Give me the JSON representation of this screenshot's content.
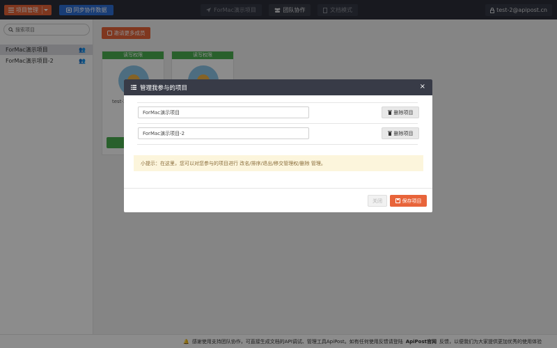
{
  "topbar": {
    "project_menu_label": "项目管理",
    "sync_label": "同步协作数据",
    "tabs": [
      {
        "label": "ForMac演示项目"
      },
      {
        "label": "团队协作"
      },
      {
        "label": "文档模式"
      }
    ],
    "user_email": "test-2@apipost.cn"
  },
  "sidebar": {
    "search_placeholder": "搜索项目",
    "items": [
      {
        "label": "ForMac演示项目"
      },
      {
        "label": "ForMac演示项目-2"
      }
    ]
  },
  "main": {
    "invite_label": "邀请更多成员",
    "cards": [
      {
        "permission": "读写权限",
        "name": "test-2"
      },
      {
        "permission": "读写权限"
      }
    ]
  },
  "modal": {
    "title": "管理我参与的项目",
    "close_symbol": "×",
    "projects": [
      {
        "name": "ForMac演示项目",
        "delete_label": "删除项目"
      },
      {
        "name": "ForMac演示项目-2",
        "delete_label": "删除项目"
      }
    ],
    "tip": "小提示：在这里，您可以对您参与的项目进行 改名/排序/退出/移交管理权/删除 管理。",
    "close_button": "关闭",
    "save_button": "保存项目"
  },
  "footer": {
    "text": "感谢使用支持团队协作，可直接生成文档的API调试、管理工具ApiPost。如有任何使用反馈请登陆",
    "link": "ApiPost官网",
    "tail": "反馈，以便我们为大家提供更加优秀的使用体验"
  },
  "colors": {
    "accent": "#e8643a",
    "sync_blue": "#2f6fd8",
    "topbar": "#2c2f3a",
    "permission_green": "#4caf50"
  }
}
